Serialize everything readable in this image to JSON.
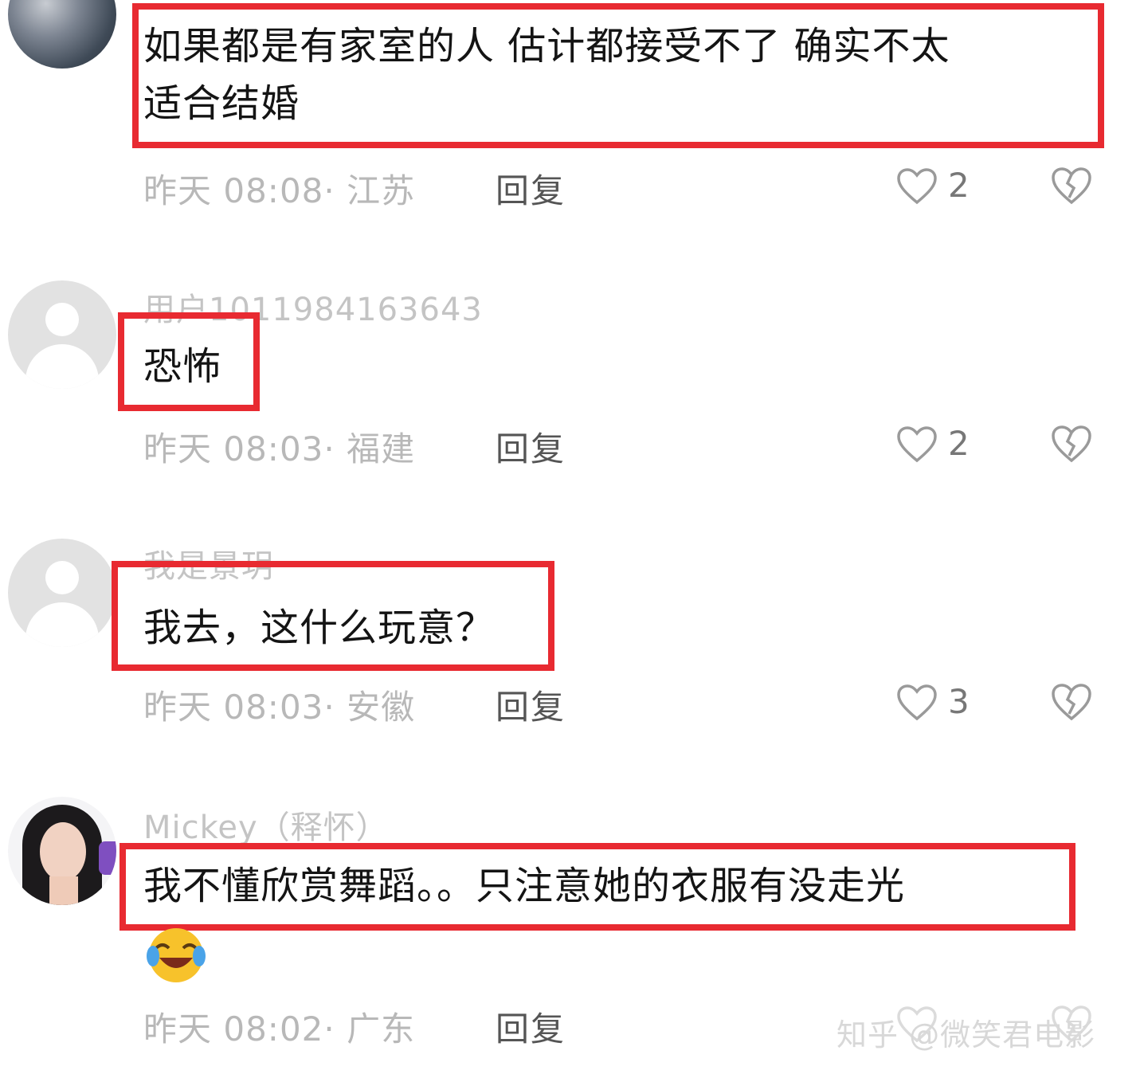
{
  "comments": [
    {
      "username": "",
      "text_line1": "如果都是有家室的人 估计都接受不了 确实不太",
      "text_line2": "适合结婚",
      "meta": "昨天 08:08· 江苏",
      "reply_label": "回复",
      "likes": "2"
    },
    {
      "username": "用户1011984163643",
      "text_line1": "恐怖",
      "meta": "昨天 08:03· 福建",
      "reply_label": "回复",
      "likes": "2"
    },
    {
      "username": "我是景玥",
      "text_line1": "我去，这什么玩意？",
      "meta": "昨天 08:03· 安徽",
      "reply_label": "回复",
      "likes": "3"
    },
    {
      "username": "Mickey（释怀）",
      "text_line1": "我不懂欣赏舞蹈。。只注意她的衣服有没走光",
      "meta": "昨天 08:02· 广东",
      "reply_label": "回复",
      "likes": ""
    }
  ],
  "watermark": "知乎 @微笑君电影",
  "colors": {
    "highlight": "#e82a31",
    "meta_gray": "#b8b8b8"
  },
  "icons": {
    "like": "heart-outline-icon",
    "dislike": "broken-heart-icon",
    "emoji": "laughing-crying-emoji"
  }
}
